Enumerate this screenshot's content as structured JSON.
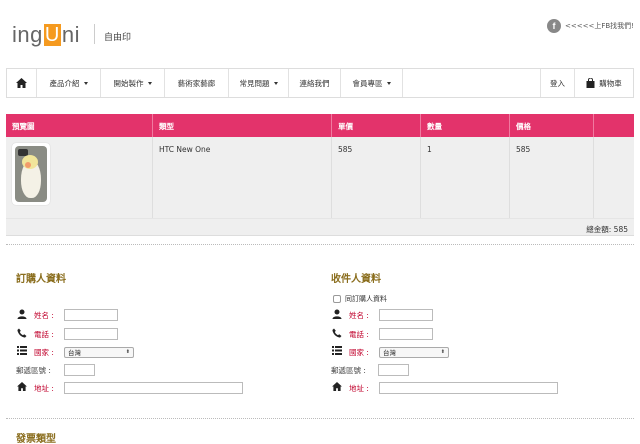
{
  "header": {
    "logo_pre": "ing",
    "logo_u": "U",
    "logo_post": "ni",
    "tagline": "自由印",
    "fb_icon": "f",
    "fb_text": "<<<<<上FB找我們!"
  },
  "nav": {
    "items": [
      {
        "label": "產品介紹",
        "caret": true
      },
      {
        "label": "開始製作",
        "caret": true
      },
      {
        "label": "藝術家藝廊",
        "caret": false
      },
      {
        "label": "常見問題",
        "caret": true
      },
      {
        "label": "連絡我們",
        "caret": false
      },
      {
        "label": "會員專區",
        "caret": true
      }
    ],
    "login": "登入",
    "cart": "購物車"
  },
  "cart": {
    "headers": [
      "預覽圖",
      "類型",
      "單價",
      "數量",
      "價格"
    ],
    "rows": [
      {
        "type": "HTC New One",
        "unit_price": "585",
        "qty": "1",
        "price": "585"
      }
    ],
    "total_label": "總金額: 585"
  },
  "buyer": {
    "title": "訂購人資料",
    "name_label": "姓名 :",
    "phone_label": "電話 :",
    "country_label": "國家 :",
    "country_value": "台灣",
    "zip_label": "郵遞區號 :",
    "address_label": "地址 :"
  },
  "receiver": {
    "title": "收件人資料",
    "same_label": "同訂購人資料",
    "name_label": "姓名 :",
    "phone_label": "電話 :",
    "country_label": "國家 :",
    "country_value": "台灣",
    "zip_label": "郵遞區號 :",
    "address_label": "地址 :"
  },
  "invoice": {
    "title": "發票類型"
  },
  "colors": {
    "accent": "#e3336b",
    "logo_orange": "#f59a1f",
    "section_title": "#8a6d1d",
    "required_label": "#c0002b"
  }
}
